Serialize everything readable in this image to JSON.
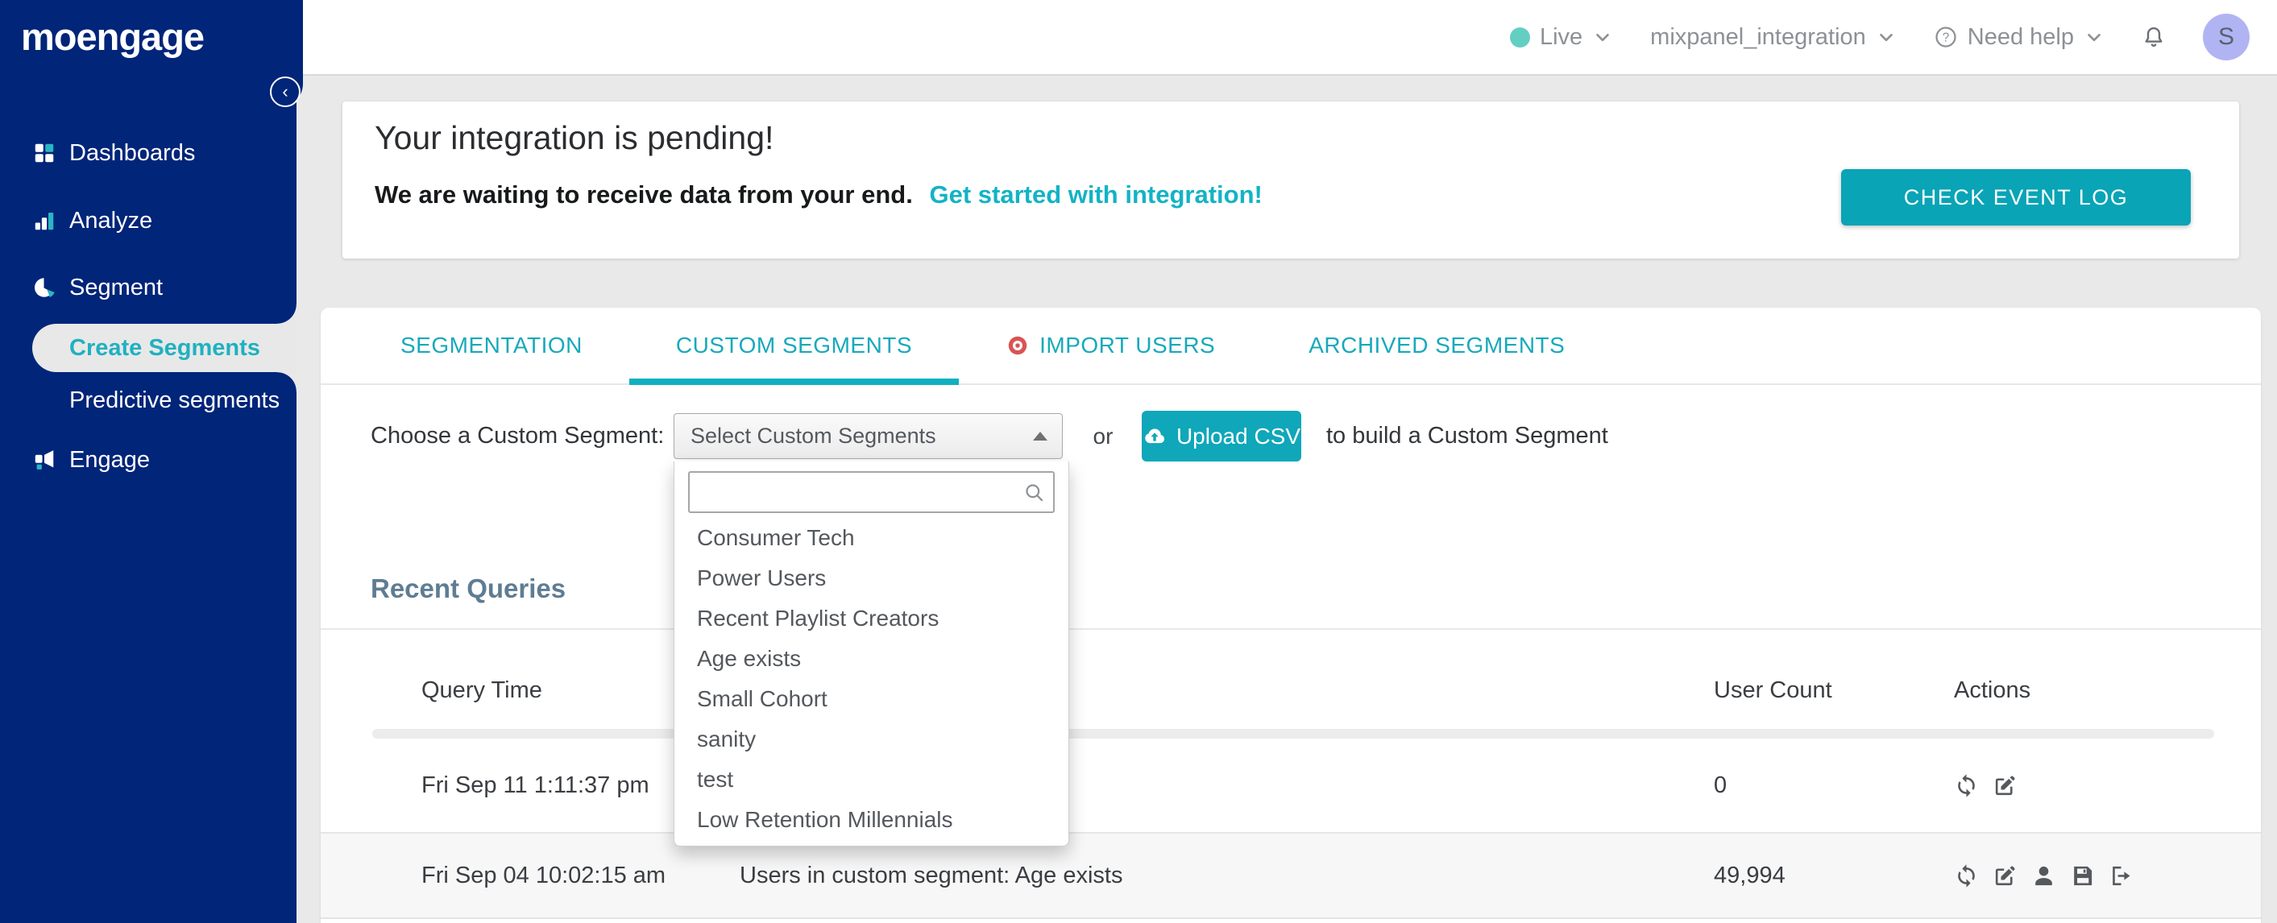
{
  "brand": {
    "logo_text": "moengage",
    "collapse_icon": "‹"
  },
  "colors": {
    "sidebar_navy": "#002579",
    "accent_teal": "#0fa7b9",
    "link_teal": "#13b3c5",
    "live_dot": "#63cfc2",
    "avatar_bg": "#b1b4f3",
    "import_dot": "#d95454",
    "heading_slate": "#5e7d93"
  },
  "topbar": {
    "live_label": "Live",
    "project": "mixpanel_integration",
    "help_label": "Need help",
    "avatar_initial": "S",
    "icons": [
      "chevron-down-icon",
      "question-circle-icon",
      "bell-icon"
    ]
  },
  "sidebar": {
    "items": [
      {
        "label": "Dashboards",
        "icon": "dashboards-grid-icon"
      },
      {
        "label": "Analyze",
        "icon": "bar-chart-icon"
      },
      {
        "label": "Segment",
        "icon": "pie-chart-icon"
      },
      {
        "label": "Engage",
        "icon": "megaphone-icon"
      }
    ],
    "sub": [
      {
        "label": "Create Segments",
        "active": true
      },
      {
        "label": "Predictive segments",
        "active": false
      }
    ]
  },
  "banner": {
    "title": "Your integration is pending!",
    "subtitle": "We are waiting to receive data from your end.",
    "link_text": "Get started with integration!",
    "button_label": "CHECK EVENT LOG"
  },
  "tabs": [
    {
      "label": "SEGMENTATION",
      "active": false
    },
    {
      "label": "CUSTOM SEGMENTS",
      "active": true
    },
    {
      "label": "IMPORT USERS",
      "active": false,
      "icon": "red-target-dot-icon"
    },
    {
      "label": "ARCHIVED SEGMENTS",
      "active": false
    }
  ],
  "chooser": {
    "label": "Choose a Custom Segment:",
    "select_value": "Select Custom Segments",
    "or_text": "or",
    "upload_label": "Upload CSV",
    "upload_icon": "cloud-upload-icon",
    "suffix": "to build a Custom Segment",
    "search_value": ""
  },
  "dropdown": {
    "items": [
      "Consumer Tech",
      "Power Users",
      "Recent Playlist Creators",
      "Age exists",
      "Small Cohort",
      "sanity",
      "test",
      "Low Retention Millennials"
    ]
  },
  "recent": {
    "heading": "Recent Queries",
    "columns": [
      "Query Time",
      "User Count",
      "Actions"
    ],
    "rows": [
      {
        "time": "Fri Sep 11 1:11:37 pm",
        "description": "",
        "count": "0",
        "actions": [
          "refresh-icon",
          "edit-icon"
        ]
      },
      {
        "time": "Fri Sep 04 10:02:15 am",
        "description": "Users in custom segment: Age exists",
        "count": "49,994",
        "actions": [
          "refresh-icon",
          "edit-icon",
          "user-icon",
          "save-icon",
          "export-icon"
        ]
      }
    ]
  }
}
